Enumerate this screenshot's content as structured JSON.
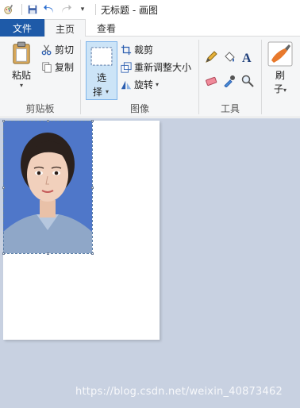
{
  "window": {
    "title": "无标题 - 画图"
  },
  "tabs": {
    "file": "文件",
    "home": "主页",
    "view": "查看"
  },
  "clipboard": {
    "paste": "粘贴",
    "cut": "剪切",
    "copy": "复制",
    "label": "剪贴板"
  },
  "image": {
    "select_top": "选",
    "select_bottom": "择",
    "crop": "裁剪",
    "resize": "重新调整大小",
    "rotate": "旋转",
    "label": "图像"
  },
  "tools": {
    "label": "工具"
  },
  "brushes": {
    "top": "刷",
    "bottom": "子"
  },
  "watermark": "https://blog.csdn.net/weixin_40873462",
  "colors": {
    "accent": "#1e5aa8",
    "canvas_bg": "#c8d1e1",
    "photo_bg": "#4f77c9",
    "select_bg": "#cce4f7"
  }
}
